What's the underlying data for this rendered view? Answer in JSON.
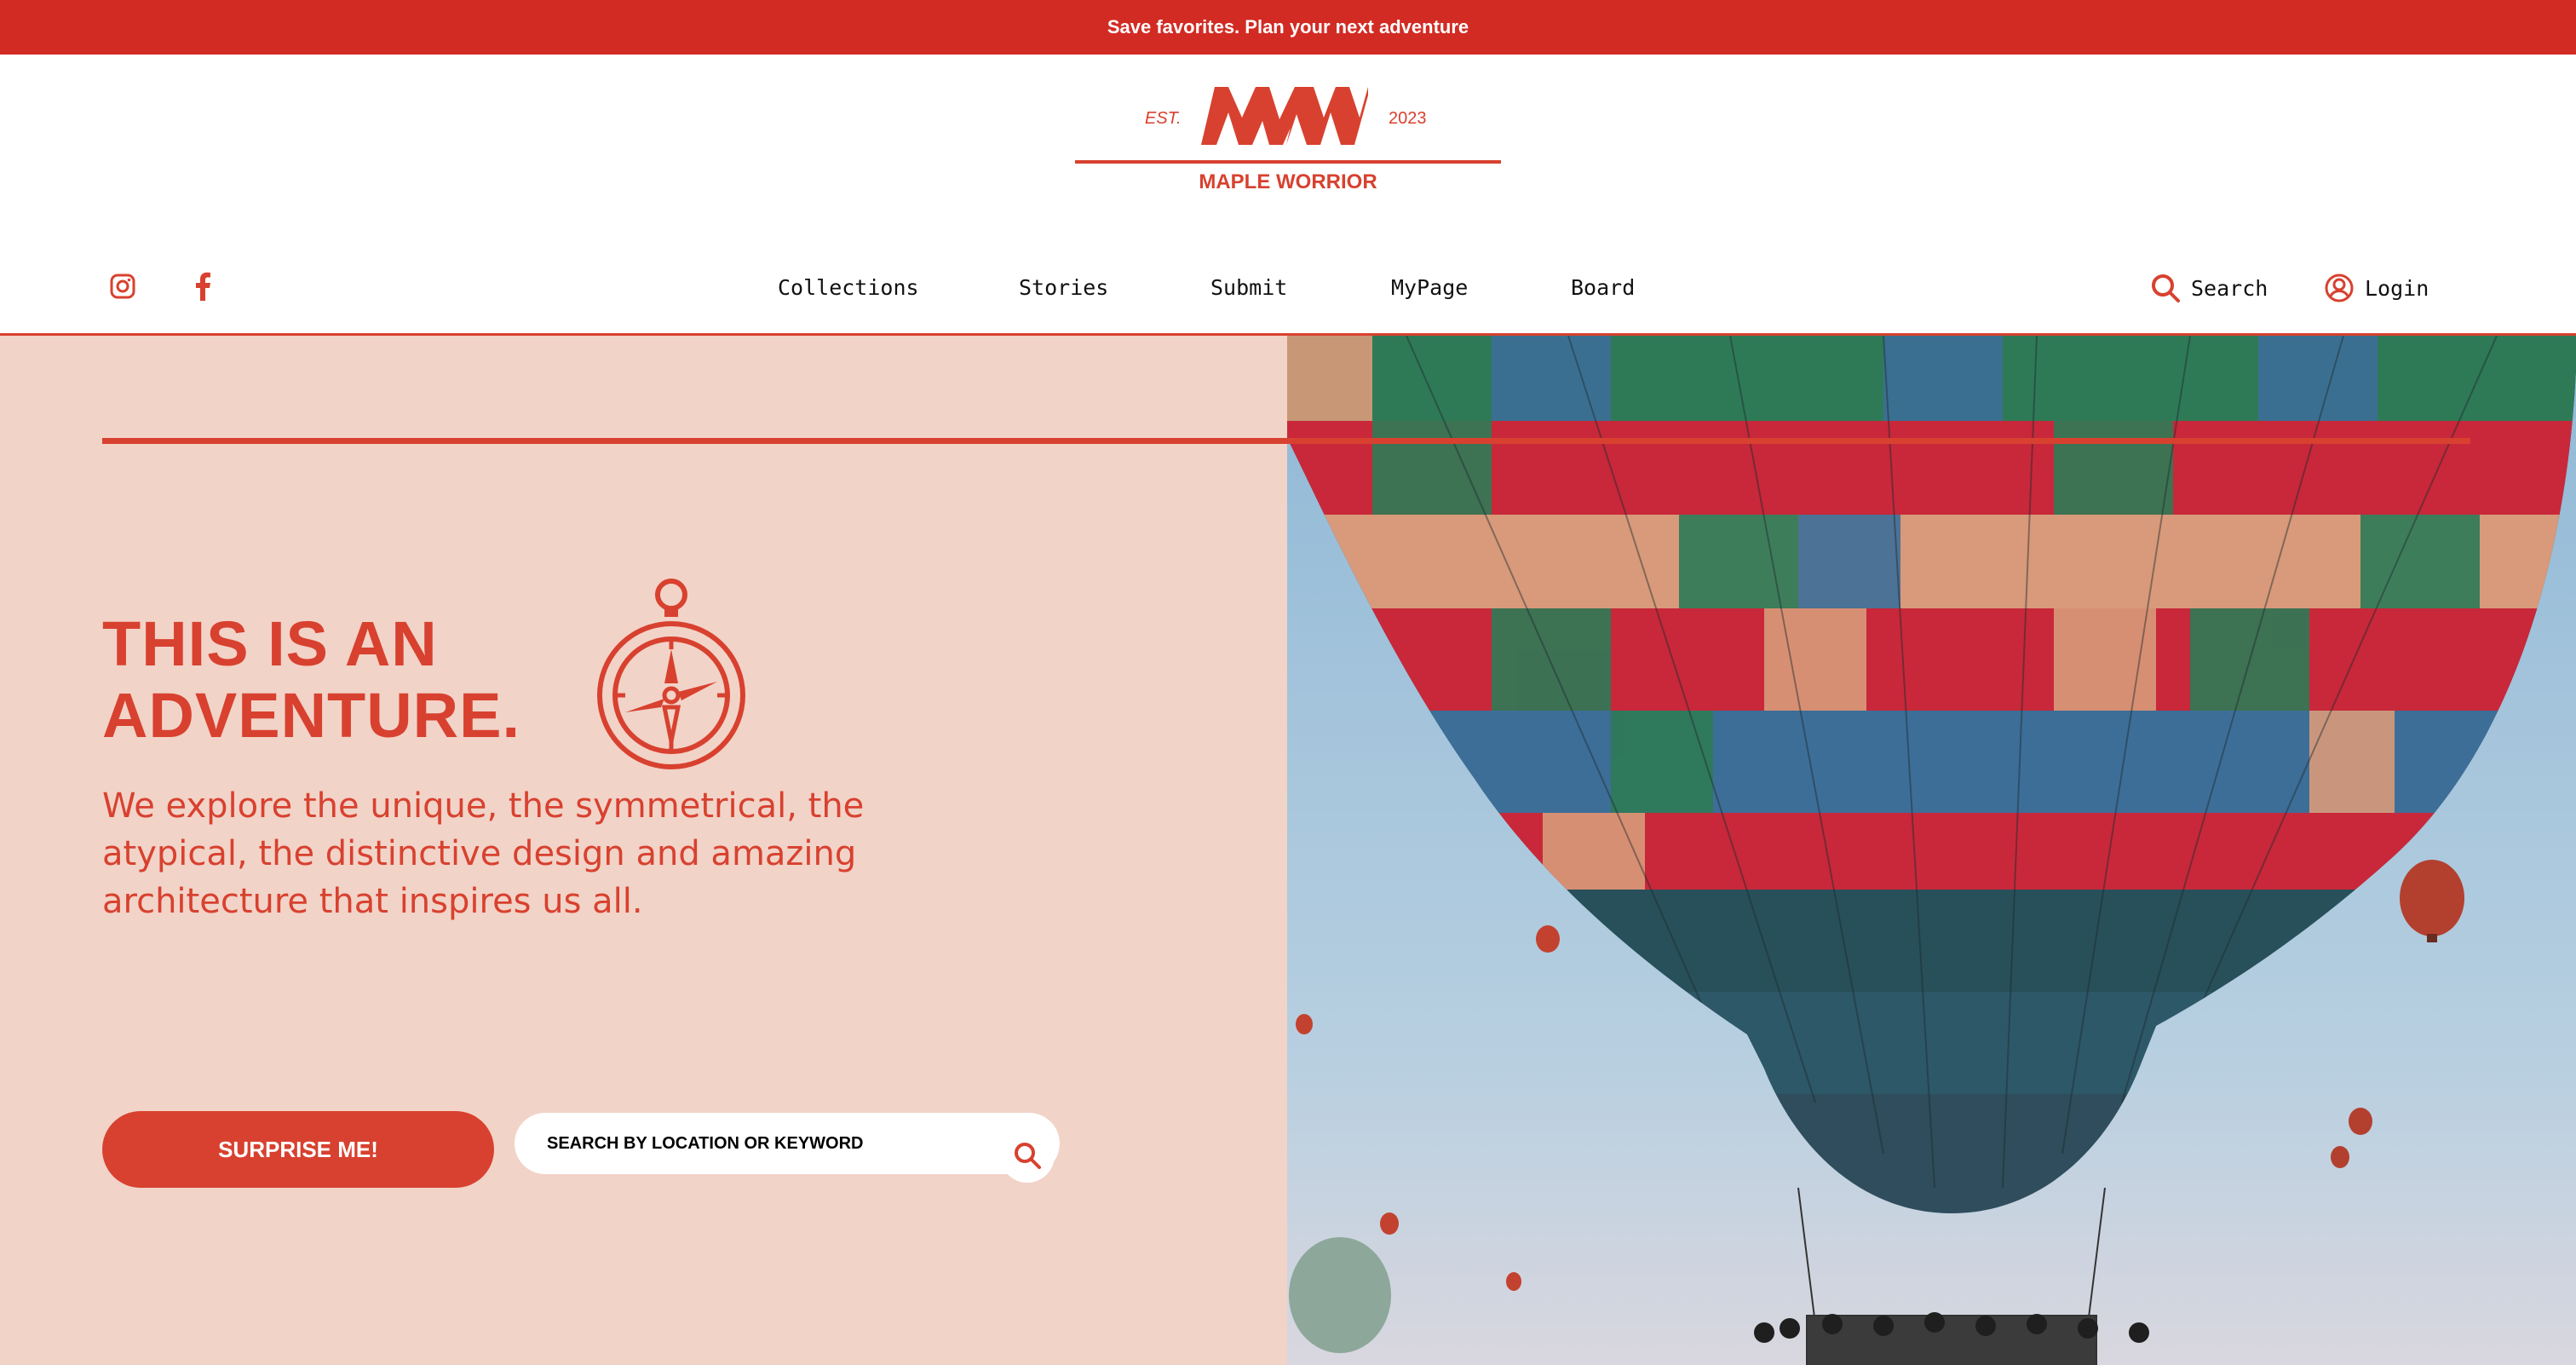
{
  "announcement": {
    "text": "Save favorites. Plan your next adventure"
  },
  "brand": {
    "est": "EST.",
    "year": "2023",
    "monogram": "MW",
    "name": "MAPLE WORRIOR",
    "color": "#d8412f"
  },
  "social": {
    "instagram_icon": "instagram-icon",
    "facebook_icon": "facebook-icon"
  },
  "nav": {
    "items": [
      {
        "label": "Collections"
      },
      {
        "label": "Stories"
      },
      {
        "label": "Submit"
      },
      {
        "label": "MyPage"
      },
      {
        "label": "Board"
      }
    ]
  },
  "utility": {
    "search_label": "Search",
    "search_icon": "search-icon",
    "login_label": "Login",
    "login_icon": "user-icon"
  },
  "hero": {
    "title_line1": "THIS IS AN",
    "title_line2": "ADVENTURE.",
    "icon": "compass-icon",
    "description": "We explore the unique, the symmetrical, the atypical, the distinctive design and amazing architecture that inspires us all.",
    "cta_label": "SURPRISE ME!",
    "search_placeholder": "SEARCH BY LOCATION OR KEYWORD",
    "image_alt": "hot-air-balloon-photo",
    "background_color": "#f2d3c8"
  }
}
